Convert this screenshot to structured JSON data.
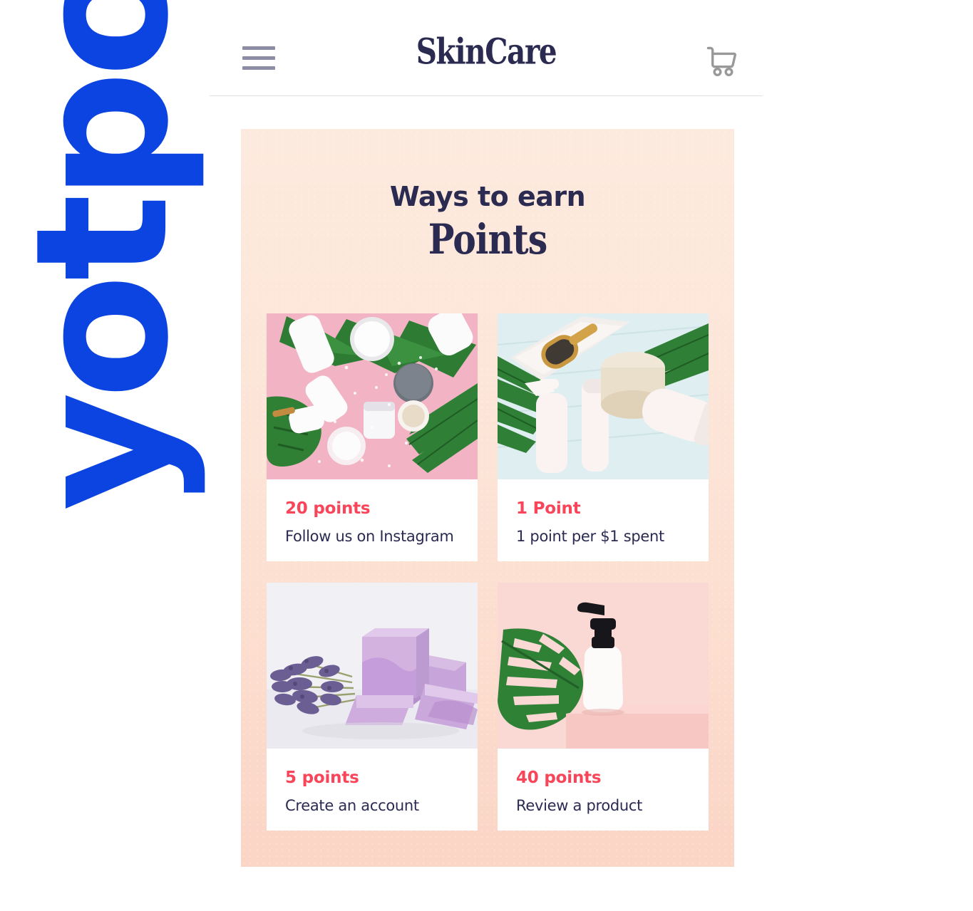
{
  "brand": {
    "yotpo_logo_text": "yotpo",
    "yotpo_logo_color": "#0b44e0"
  },
  "header": {
    "menu_icon": "hamburger-icon",
    "store_name": "SkinCare",
    "cart_icon": "shopping-cart-icon"
  },
  "panel": {
    "heading_line_1": "Ways to earn",
    "heading_line_2": "Points",
    "heading_color": "#2b2b52",
    "background_color": "#fce8dc",
    "points_color": "#f9455a"
  },
  "rewards": [
    {
      "points": "20 points",
      "description": "Follow us on Instagram",
      "image_alt": "White skincare bottles and jars on pink background with green palm leaves"
    },
    {
      "points": "1 Point",
      "description": "1 point per $1 spent",
      "image_alt": "Bath products, towel and wooden hairbrush on pale blue wood with palm fronds"
    },
    {
      "points": "5 points",
      "description": "Create an account",
      "image_alt": "Purple lavender soap bars beside a bundle of dried lavender"
    },
    {
      "points": "40 points",
      "description": "Review a product",
      "image_alt": "White pump bottle on a pink pedestal with a monstera leaf"
    }
  ]
}
